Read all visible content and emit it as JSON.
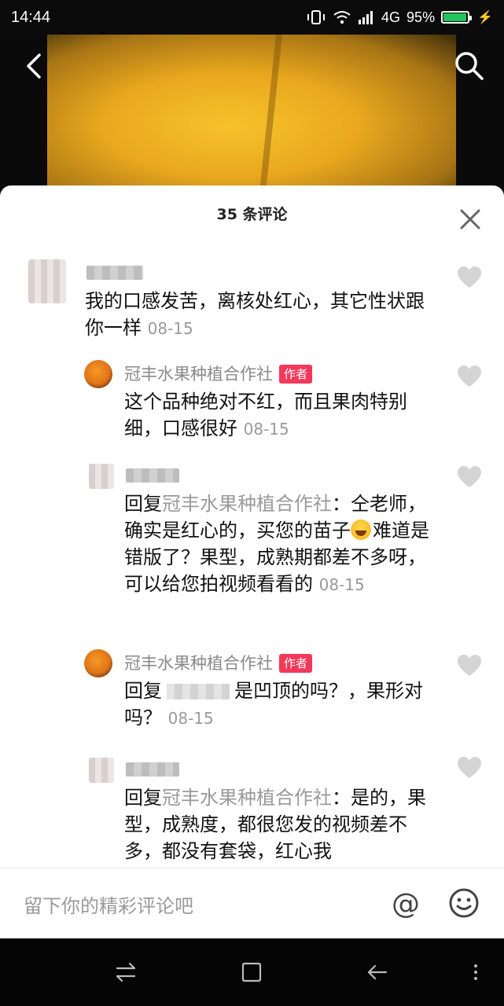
{
  "status": {
    "time": "14:44",
    "network": "4G",
    "battery": "95%",
    "battery_level": 0.95
  },
  "video": {
    "back_icon": "chevron-left-icon",
    "search_icon": "search-icon"
  },
  "sheet": {
    "title": "35 条评论",
    "close_icon": "close-icon"
  },
  "comments": [
    {
      "text": "我的口感发苦，离核处红心，其它性状跟你一样",
      "date": "08-15"
    },
    {
      "name": "冠丰水果种植合作社",
      "badge": "作者",
      "text": "这个品种绝对不红，而且果肉特别细，口感很好",
      "date": "08-15"
    },
    {
      "reply_prefix": "回复",
      "reply_to": "冠丰水果种植合作社",
      "text_a": "：仝老师，确实是红心的，买您的苗子",
      "text_b": "难道是错版了？果型，成熟期都差不多呀，可以给您拍视频看看的",
      "date": "08-15"
    },
    {
      "name": "冠丰水果种植合作社",
      "badge": "作者",
      "reply_prefix": "回复",
      "text_a": "是凹顶的吗？，果形对吗？",
      "date": "08-15"
    },
    {
      "reply_prefix": "回复",
      "reply_to": "冠丰水果种植合作社",
      "text": "：是的，果型，成熟度，都很您发的视频差不多，都没有套袋，红心我"
    }
  ],
  "input": {
    "placeholder": "留下你的精彩评论吧",
    "at_symbol": "@"
  }
}
